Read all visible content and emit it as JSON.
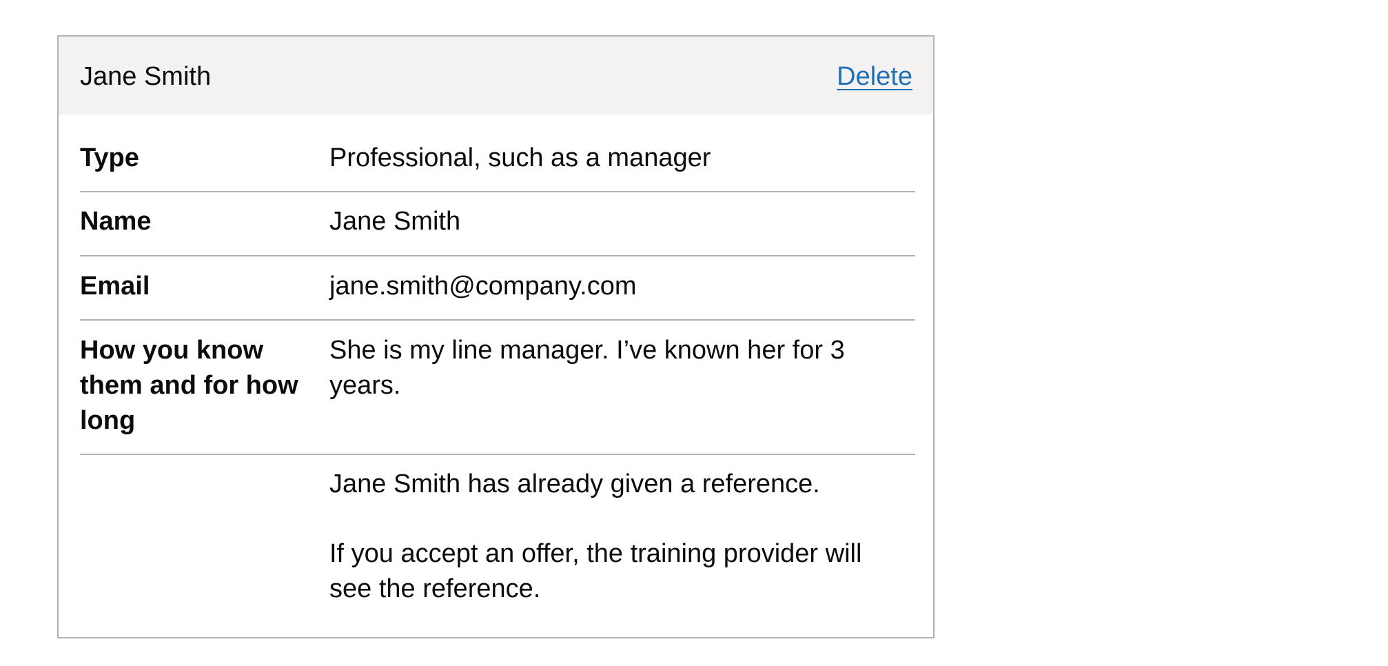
{
  "card": {
    "title": "Jane Smith",
    "delete_label": "Delete"
  },
  "rows": [
    {
      "key": "Type",
      "value": "Professional, such as a manager"
    },
    {
      "key": "Name",
      "value": "Jane Smith"
    },
    {
      "key": "Email",
      "value": "jane.smith@company.com"
    },
    {
      "key": "How you know them and for how long",
      "value": "She is my line manager. I’ve known her for 3 years."
    }
  ],
  "notice": {
    "line1": "Jane Smith has already given a reference.",
    "line2": "If you accept an offer, the training provider will see the reference."
  },
  "colors": {
    "link": "#1d70b8",
    "header_bg": "#f3f2f1",
    "border": "#b1b4b6",
    "text": "#0b0c0c"
  }
}
